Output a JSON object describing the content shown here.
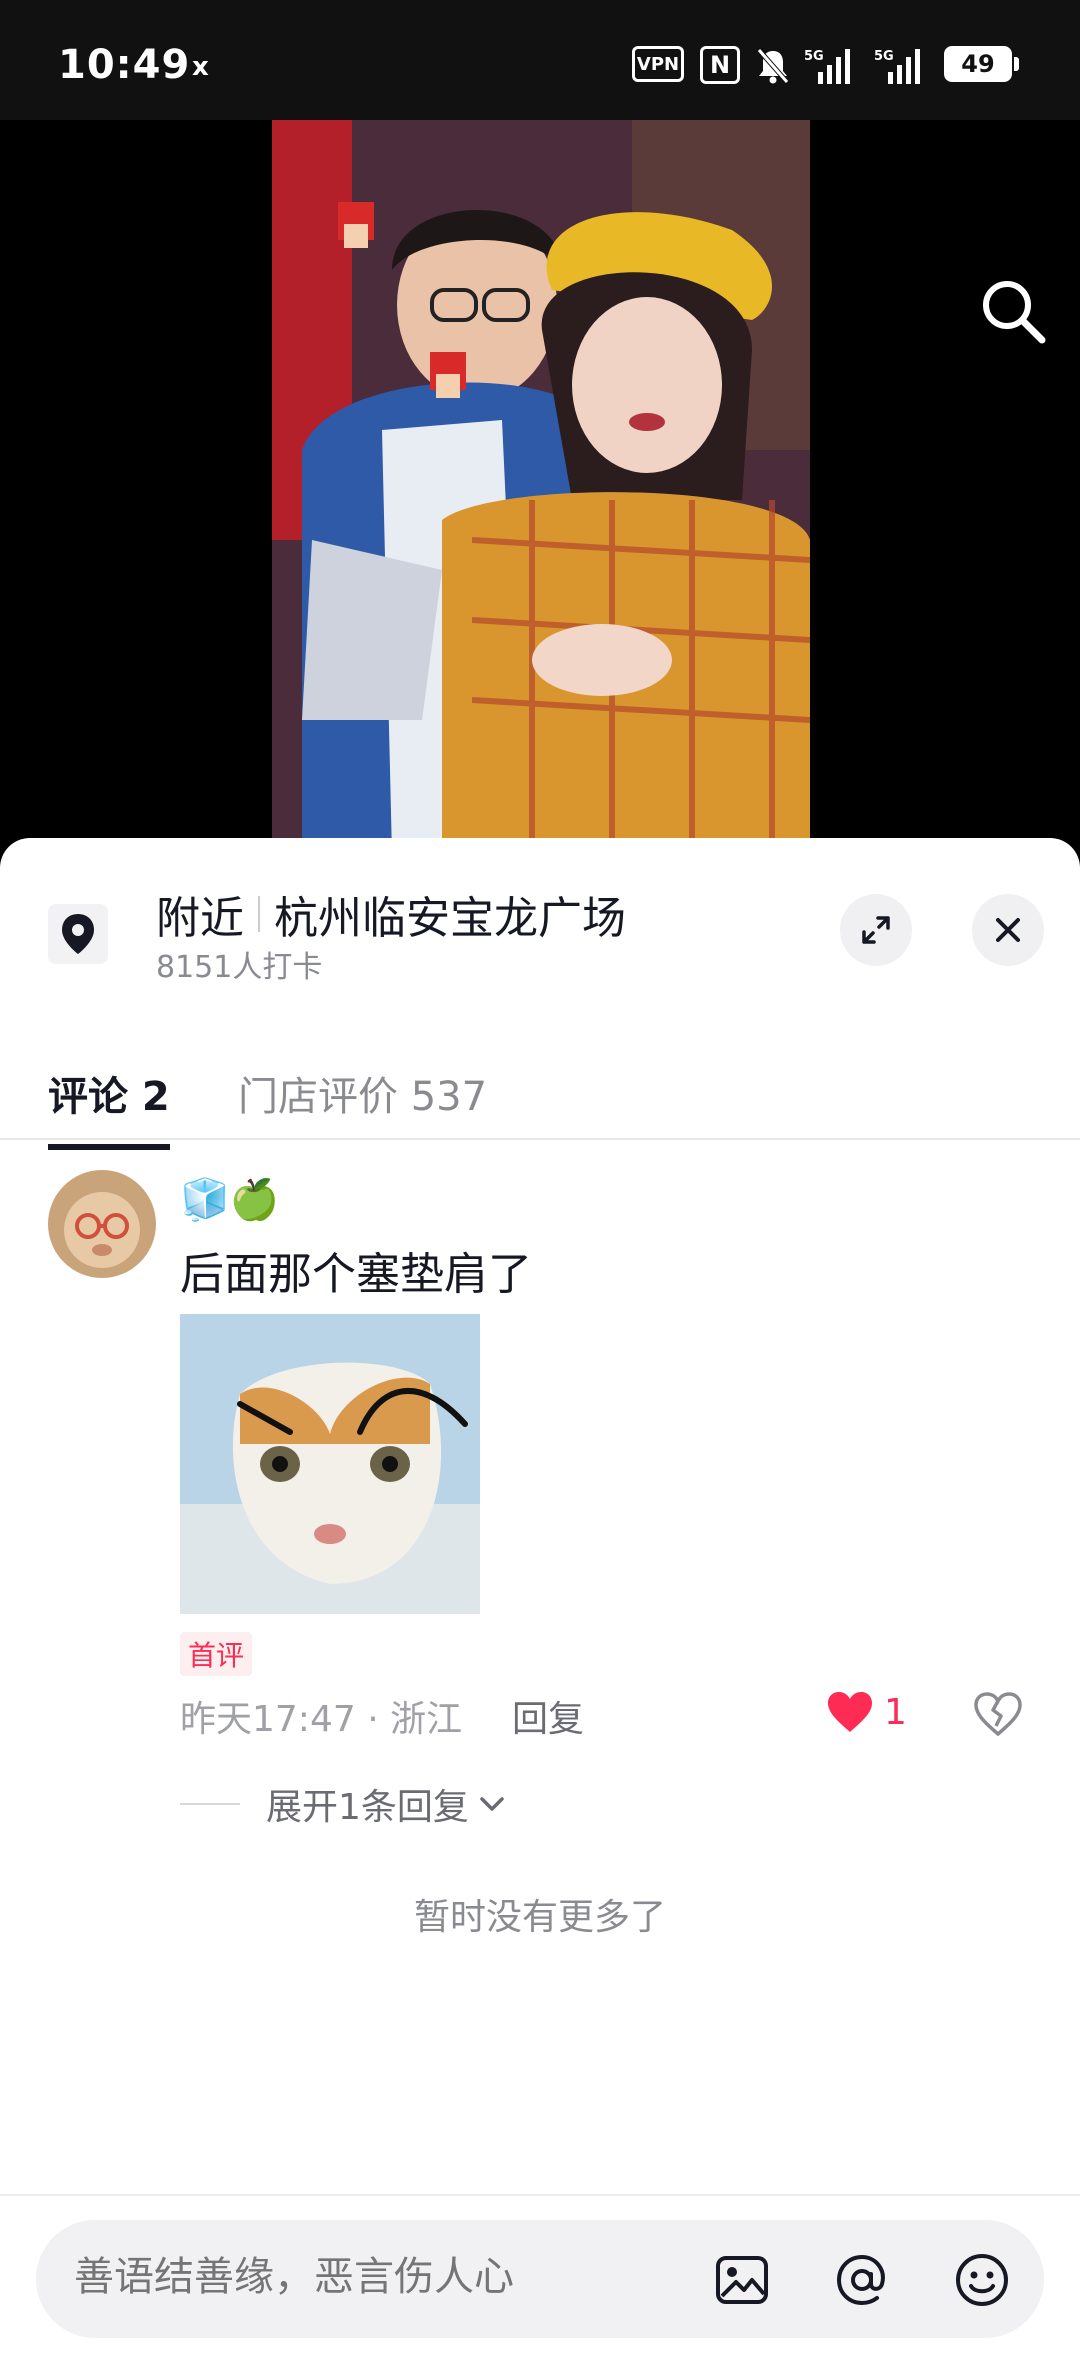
{
  "status_bar": {
    "time": "10:49",
    "x_label": "x",
    "vpn_label": "VPN",
    "nfc_label": "N",
    "signal1_label": "5G",
    "signal2_label": "5G",
    "battery": "49"
  },
  "video": {
    "search_icon": "search-icon"
  },
  "location": {
    "prefix": "附近",
    "name": "杭州临安宝龙广场",
    "checkins": "8151人打卡",
    "pin_icon": "location-pin-icon"
  },
  "tabs": {
    "comments": "评论 2",
    "reviews": "门店评价 537"
  },
  "comment": {
    "nickname_emoji": "🧊🍏",
    "text": "后面那个塞垫肩了",
    "badge": "首评",
    "meta": "昨天17:47 · 浙江",
    "reply": "回复",
    "likes": "1",
    "expand_replies": "展开1条回复"
  },
  "footer_text": "暂时没有更多了",
  "input": {
    "placeholder": "善语结善缘，恶言伤人心"
  },
  "colors": {
    "accent": "#fe2c55",
    "text_primary": "#161823",
    "text_secondary": "#8a8b91"
  }
}
